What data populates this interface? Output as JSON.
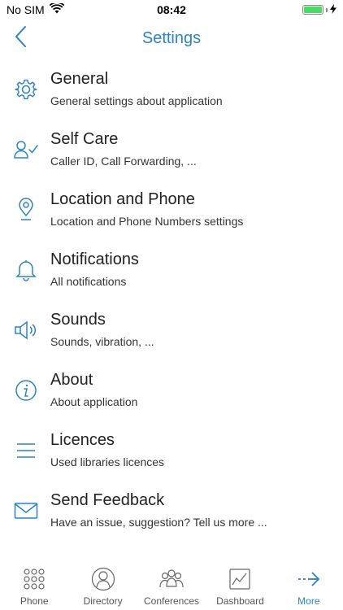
{
  "status_bar": {
    "carrier": "No SIM",
    "time": "08:42",
    "battery_color": "#4cd964"
  },
  "nav": {
    "title": "Settings",
    "back_icon": "chevron-left-icon"
  },
  "accent_color": "#2b83c6",
  "items": [
    {
      "title": "General",
      "subtitle": "General settings about application",
      "icon": "gear-icon"
    },
    {
      "title": "Self Care",
      "subtitle": "Caller ID, Call Forwarding, ...",
      "icon": "user-check-icon"
    },
    {
      "title": "Location and Phone",
      "subtitle": "Location and Phone Numbers settings",
      "icon": "location-pin-icon"
    },
    {
      "title": "Notifications",
      "subtitle": "All notifications",
      "icon": "bell-icon"
    },
    {
      "title": "Sounds",
      "subtitle": "Sounds, vibration, ...",
      "icon": "speaker-icon"
    },
    {
      "title": "About",
      "subtitle": "About application",
      "icon": "info-icon"
    },
    {
      "title": "Licences",
      "subtitle": "Used libraries licences",
      "icon": "list-lines-icon"
    },
    {
      "title": "Send Feedback",
      "subtitle": "Have an issue, suggestion? Tell us more ...",
      "icon": "envelope-icon"
    }
  ],
  "tabs": [
    {
      "label": "Phone",
      "icon": "dialpad-icon"
    },
    {
      "label": "Directory",
      "icon": "person-circle-icon"
    },
    {
      "label": "Conferences",
      "icon": "group-icon"
    },
    {
      "label": "Dashboard",
      "icon": "chart-icon"
    },
    {
      "label": "More",
      "icon": "arrow-right-icon",
      "active": true
    }
  ]
}
